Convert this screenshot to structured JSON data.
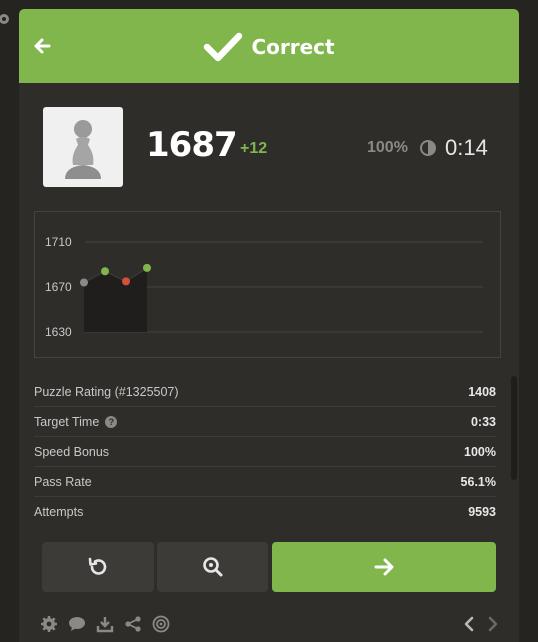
{
  "header": {
    "title": "Correct"
  },
  "player": {
    "rating": "1687",
    "rating_delta": "+12",
    "accuracy": "100%",
    "timer": "0:14"
  },
  "chart_data": {
    "type": "line",
    "y_ticks": [
      1710,
      1670,
      1630
    ],
    "ylim": [
      1630,
      1710
    ],
    "points": [
      {
        "x": 0,
        "y": 1674,
        "color": "#8b8987"
      },
      {
        "x": 1,
        "y": 1684,
        "color": "#81b64c"
      },
      {
        "x": 2,
        "y": 1675,
        "color": "#d64f3a"
      },
      {
        "x": 3,
        "y": 1687,
        "color": "#81b64c"
      }
    ],
    "grid": true
  },
  "stats": {
    "puzzle_rating_label": "Puzzle Rating (#1325507)",
    "puzzle_rating": "1408",
    "target_time_label": "Target Time",
    "target_time": "0:33",
    "speed_bonus_label": "Speed Bonus",
    "speed_bonus": "100%",
    "pass_rate_label": "Pass Rate",
    "pass_rate": "56.1%",
    "attempts_label": "Attempts",
    "attempts": "9593"
  },
  "help_glyph": "?",
  "colors": {
    "accent": "#81b64c",
    "background": "#262421",
    "panel": "#2f2d2a",
    "fail": "#d64f3a"
  },
  "icons": [
    "gear-icon",
    "back-arrow-icon",
    "checkmark-icon",
    "pawn-icon",
    "clock-icon",
    "help-icon",
    "retry-icon",
    "analyze-icon",
    "next-arrow-icon",
    "chat-icon",
    "download-icon",
    "share-icon",
    "target-icon",
    "chevron-left-icon",
    "chevron-right-icon"
  ]
}
